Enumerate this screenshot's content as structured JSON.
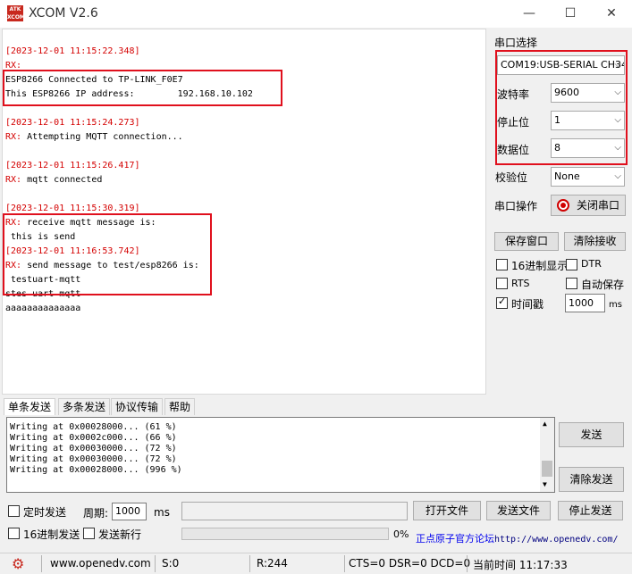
{
  "window": {
    "logo_text": "ATK XCOM",
    "title": "XCOM V2.6",
    "min": "—",
    "max": "☐",
    "close": "✕"
  },
  "receive": {
    "lines": [
      {
        "ts": "[2023-12-01 11:15:22.348]"
      },
      {
        "rx": "RX:",
        "text": ""
      },
      {
        "text": "ESP8266 Connected to TP-LINK_F0E7"
      },
      {
        "text": "This ESP8266 IP address:        192.168.10.102"
      },
      {
        "ts": "[2023-12-01 11:15:24.273]"
      },
      {
        "rx": "RX:",
        "text": " Attempting MQTT connection..."
      },
      {
        "ts": "[2023-12-01 11:15:26.417]"
      },
      {
        "rx": "RX:",
        "text": " mqtt connected"
      },
      {
        "ts": "[2023-12-01 11:15:30.319]"
      },
      {
        "rx": "RX:",
        "text": " receive mqtt message is:"
      },
      {
        "text": " this is send"
      },
      {
        "ts": "[2023-12-01 11:16:53.742]"
      },
      {
        "rx": "RX:",
        "text": " send message to test/esp8266 is:"
      },
      {
        "text": " testuart-mqtt"
      },
      {
        "text": "stes uart mqtt"
      },
      {
        "text": "aaaaaaaaaaaaaa"
      }
    ]
  },
  "port": {
    "section_label": "串口选择",
    "port_value": "COM19:USB-SERIAL CH34",
    "baud_label": "波特率",
    "baud_value": "9600",
    "stop_label": "停止位",
    "stop_value": "1",
    "data_label": "数据位",
    "data_value": "8",
    "parity_label": "校验位",
    "parity_value": "None",
    "op_label": "串口操作",
    "op_button": "关闭串口",
    "save_window": "保存窗口",
    "clear_receive": "清除接收",
    "hex_display": "16进制显示",
    "dtr": "DTR",
    "rts": "RTS",
    "auto_save": "自动保存",
    "timestamp": "时间戳",
    "timestamp_ms": "1000",
    "ms": "ms"
  },
  "tabs": [
    "单条发送",
    "多条发送",
    "协议传输",
    "帮助"
  ],
  "send": {
    "lines": [
      "Writing at 0x00028000... (61 %)",
      "Writing at 0x0002c000... (66 %)",
      "Writing at 0x00030000... (72 %)",
      "Writing at 0x00030000... (72 %)",
      "Writing at 0x00028000... (996 %)"
    ],
    "send_button": "发送",
    "clear_send_button": "清除发送",
    "timed_send": "定时发送",
    "period_label": "周期:",
    "period_value": "1000",
    "period_unit": "ms",
    "open_file": "打开文件",
    "send_file": "发送文件",
    "stop_send": "停止发送",
    "hex_send": "16进制发送",
    "send_newline": "发送新行",
    "progress_text": "0%",
    "forum_text": "正点原子官方论坛",
    "forum_url": "http://www.openedv.com/"
  },
  "status": {
    "site": "www.openedv.com",
    "s": "S:0",
    "r": "R:244",
    "signals": "CTS=0 DSR=0 DCD=0",
    "time": "当前时间 11:17:33"
  },
  "colors": {
    "highlight_box": "#e0101d",
    "timestamp": "#d40000"
  }
}
